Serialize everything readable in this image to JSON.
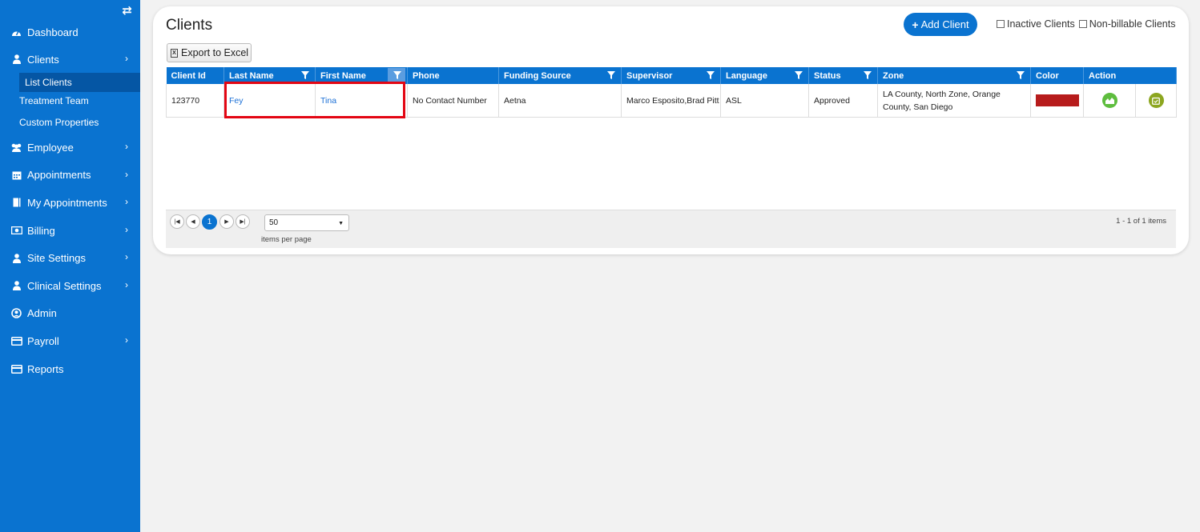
{
  "sidebar": {
    "toggle_icon": "swap-arrows-icon",
    "items": [
      {
        "label": "Dashboard",
        "icon": "dashboard-icon",
        "has_children": false
      },
      {
        "label": "Clients",
        "icon": "user-icon",
        "has_children": true,
        "expanded": true,
        "children": [
          "List Clients",
          "Treatment Team",
          "Custom Properties"
        ],
        "active_child": "List Clients"
      },
      {
        "label": "Employee",
        "icon": "users-icon",
        "has_children": true
      },
      {
        "label": "Appointments",
        "icon": "calendar-icon",
        "has_children": true
      },
      {
        "label": "My Appointments",
        "icon": "book-icon",
        "has_children": true
      },
      {
        "label": "Billing",
        "icon": "money-icon",
        "has_children": true
      },
      {
        "label": "Site Settings",
        "icon": "user-icon",
        "has_children": true
      },
      {
        "label": "Clinical Settings",
        "icon": "user-icon",
        "has_children": true
      },
      {
        "label": "Admin",
        "icon": "user-circle-icon",
        "has_children": false
      },
      {
        "label": "Payroll",
        "icon": "card-icon",
        "has_children": true
      },
      {
        "label": "Reports",
        "icon": "card-icon",
        "has_children": false
      }
    ]
  },
  "page": {
    "title": "Clients",
    "add_button": "Add Client",
    "inactive_label": "Inactive Clients",
    "nonbillable_label": "Non-billable Clients",
    "export_label": "Export to Excel"
  },
  "grid": {
    "columns": [
      "Client Id",
      "Last Name",
      "First Name",
      "Phone",
      "Funding Source",
      "Supervisor",
      "Language",
      "Status",
      "Zone",
      "Color",
      "Action"
    ],
    "rows": [
      {
        "client_id": "123770",
        "last_name": "Fey",
        "first_name": "Tina",
        "phone": "No Contact Number",
        "funding_source": "Aetna",
        "supervisor": "Marco Esposito,Brad Pitt",
        "language": "ASL",
        "status": "Approved",
        "zone": "LA County, North Zone, Orange County, San Diego",
        "color": "#b71c1c"
      }
    ]
  },
  "pager": {
    "current_page": "1",
    "per_page": "50",
    "per_page_label": "items per page",
    "info": "1 - 1 of 1 items"
  },
  "colors": {
    "accent": "#0a73d0",
    "highlight": "#e30613"
  }
}
